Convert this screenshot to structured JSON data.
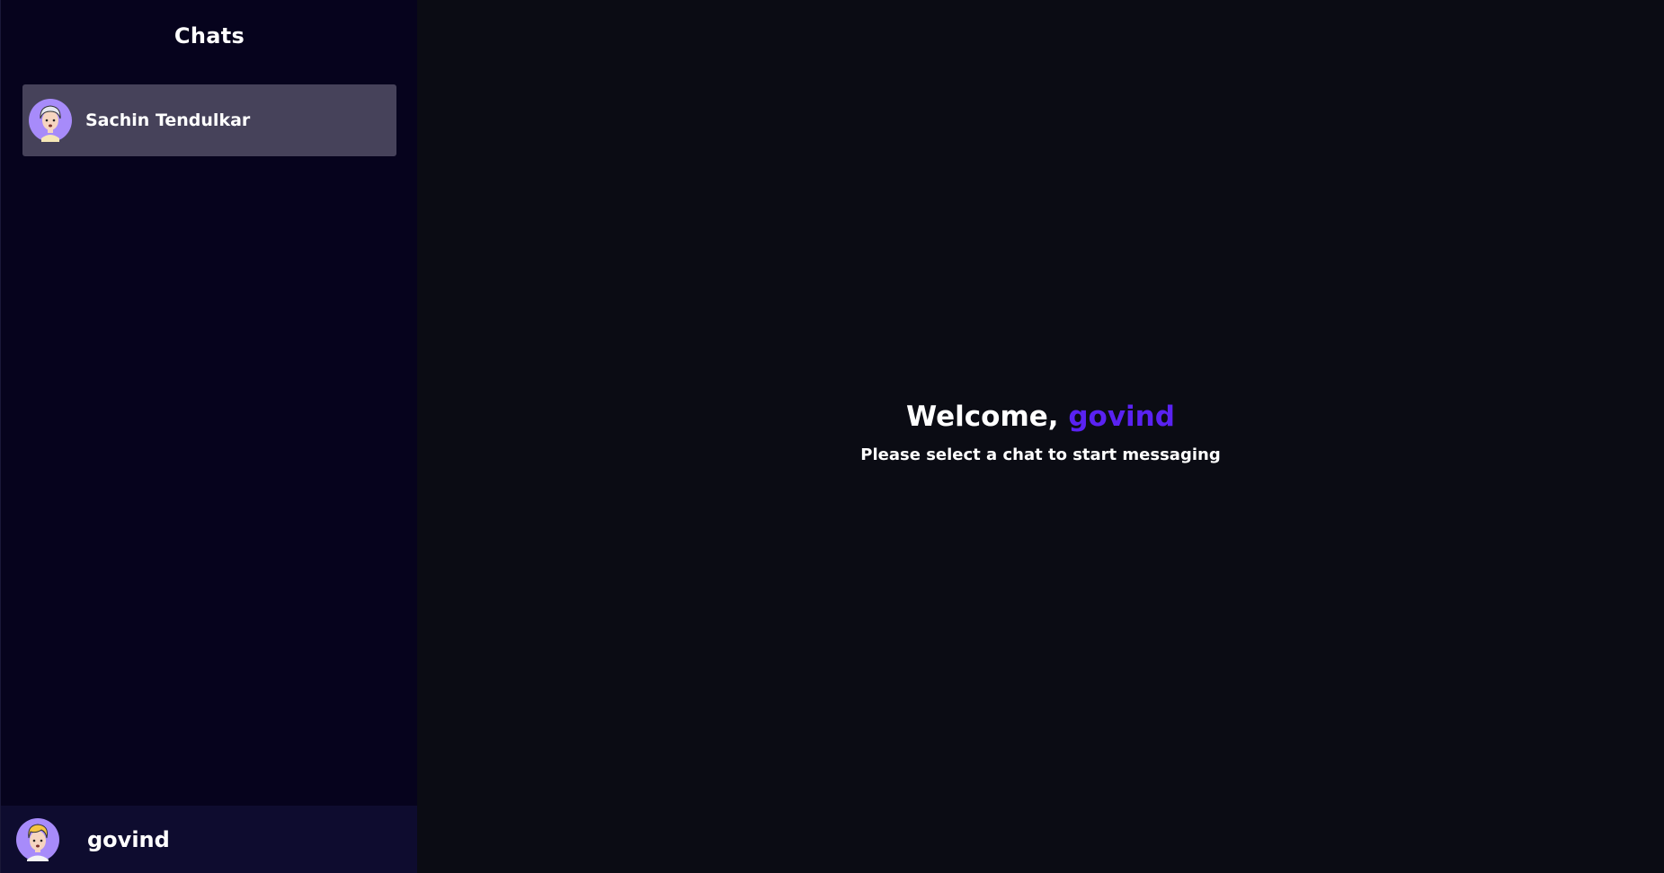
{
  "sidebar": {
    "title": "Chats",
    "chats": [
      {
        "name": "Sachin Tendulkar",
        "avatar_icon": "avatar-grey-hair-icon",
        "selected": true
      }
    ]
  },
  "current_user": {
    "username": "govind",
    "avatar_icon": "avatar-blond-hair-icon"
  },
  "main": {
    "welcome_prefix": "Welcome,",
    "welcome_user": "govind",
    "subtitle": "Please select a chat to start messaging"
  },
  "colors": {
    "sidebar_bg": "#06031d",
    "main_bg": "#0b0c14",
    "selected_chat_bg": "#46425a",
    "user_bar_bg": "#0e0c2f",
    "accent": "#5a22f2",
    "avatar_bg": "#a78bfa"
  }
}
